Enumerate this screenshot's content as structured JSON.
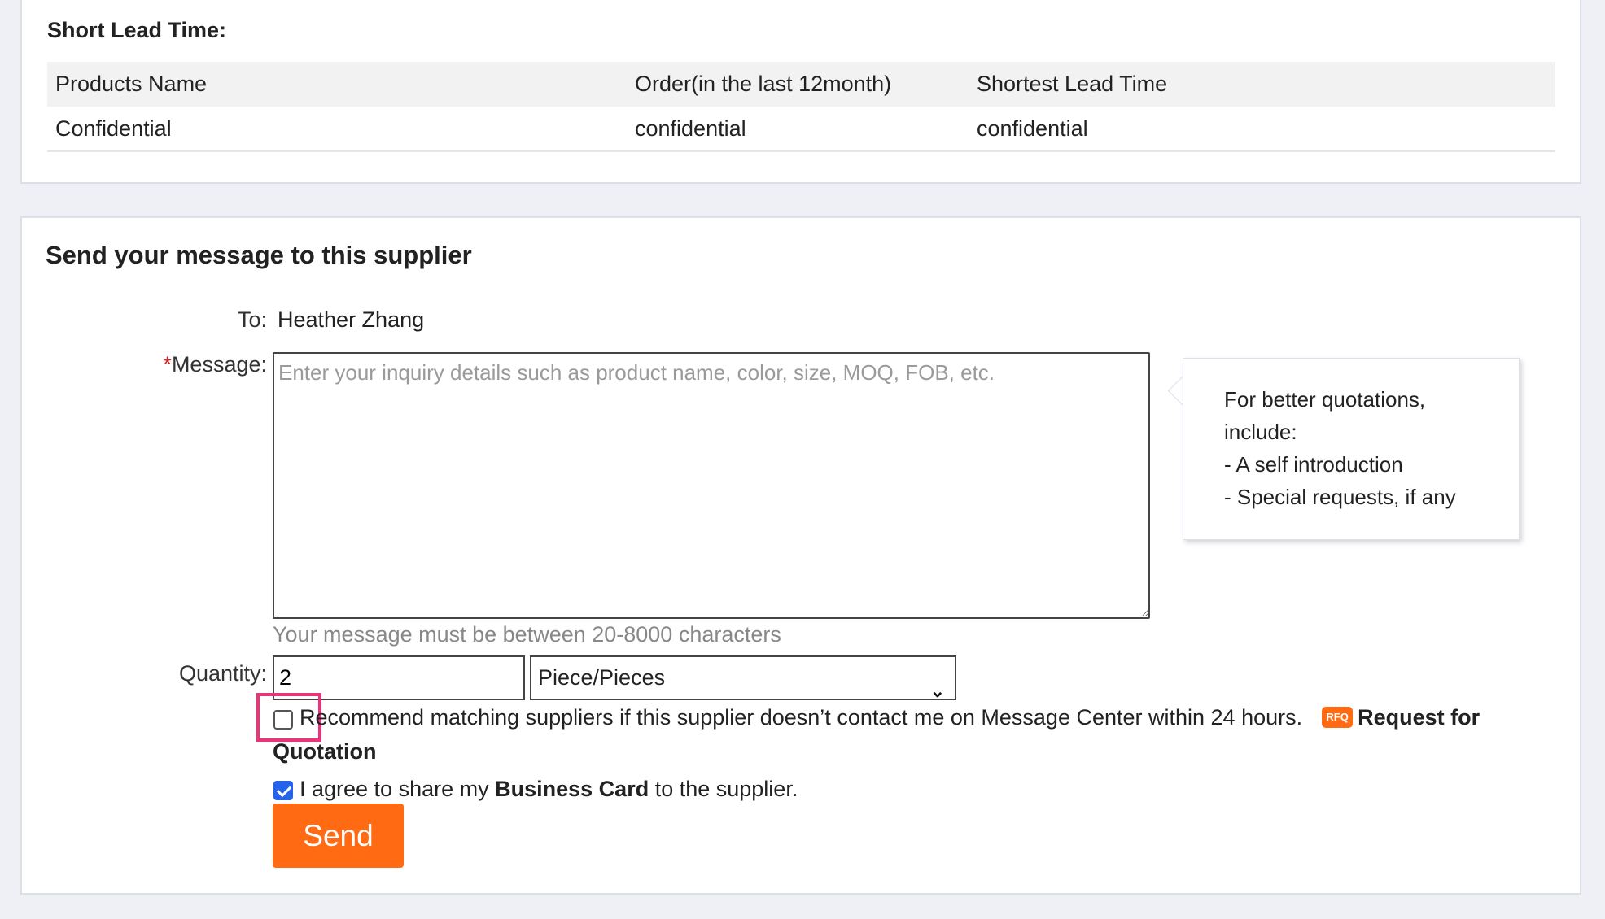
{
  "lead_time": {
    "title": "Short Lead Time:",
    "headers": [
      "Products Name",
      "Order(in the last 12month)",
      "Shortest Lead Time"
    ],
    "row": [
      "Confidential",
      "confidential",
      "confidential"
    ]
  },
  "message_form": {
    "title": "Send your message to this supplier",
    "to_label": "To:",
    "to_value": "Heather Zhang",
    "message_required_mark": "*",
    "message_label": "Message:",
    "message_placeholder": "Enter your inquiry details such as product name, color, size, MOQ, FOB, etc.",
    "hint": {
      "line1": "For better quotations,",
      "line2": "include:",
      "line3": "- A self introduction",
      "line4": "- Special requests, if any"
    },
    "chars_note": "Your message must be between 20-8000 characters",
    "quantity_label": "Quantity:",
    "quantity_value": "2",
    "unit_selected": "Piece/Pieces",
    "recommend_text": "Recommend matching suppliers if this supplier doesn’t contact me on Message Center within 24 hours.",
    "rfq_badge": "RFQ",
    "rfq_link_part1": "Request for",
    "rfq_link_part2": "Quotation",
    "recommend_checked": false,
    "agree_prefix": "I agree to share my ",
    "agree_bold": "Business Card",
    "agree_suffix": " to the supplier.",
    "agree_checked": true,
    "send_label": "Send"
  },
  "colors": {
    "accent": "#ff6a13",
    "checkbox_checked": "#2563eb",
    "highlight": "#e8357a",
    "required": "#e02020"
  }
}
